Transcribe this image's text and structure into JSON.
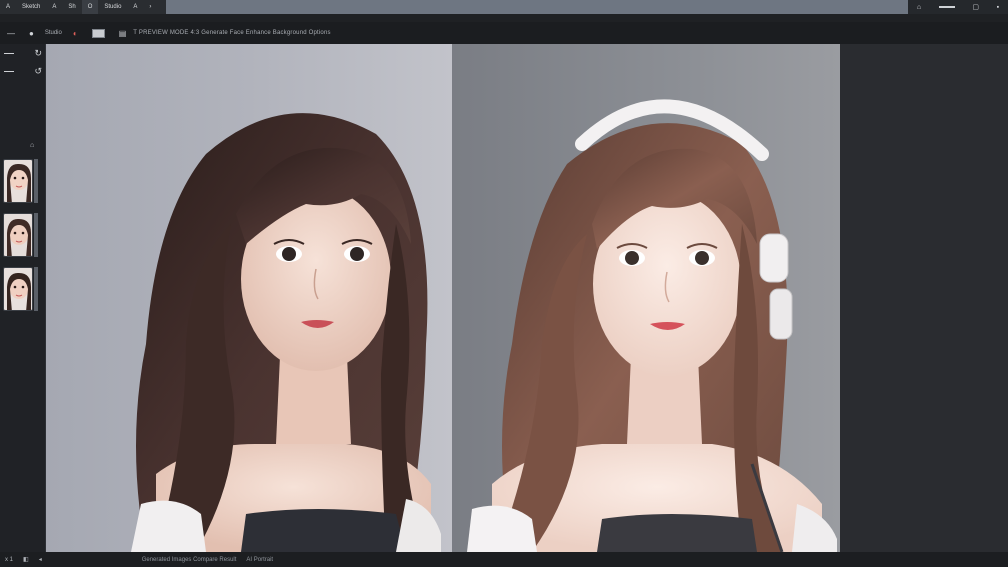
{
  "menubar": {
    "items": [
      {
        "label": "A"
      },
      {
        "label": "Sketch"
      },
      {
        "label": "A"
      },
      {
        "label": "Sh"
      },
      {
        "label": "O"
      },
      {
        "label": "Studio"
      },
      {
        "label": "A"
      },
      {
        "label": "›"
      }
    ],
    "right_icons": [
      "camera-icon",
      "minimize-icon",
      "restore-icon",
      "close-icon"
    ]
  },
  "toolbar": {
    "tool_labels": [
      "Studio"
    ],
    "status": "T PREVIEW MODE  4:3  Generate  Face Enhance  Background  Options"
  },
  "left_panel": {
    "thumbnails": [
      {
        "name": "variant-1"
      },
      {
        "name": "variant-2"
      },
      {
        "name": "variant-3"
      }
    ]
  },
  "statusbar": {
    "left": "x 1",
    "mid_items": [
      "Generated Images  Compare Result",
      "AI Portrait"
    ]
  },
  "colors": {
    "accent_red": "#e0605a",
    "canvas_left_bg": "#b1b3bc",
    "canvas_right_bg": "#8c8f95"
  }
}
